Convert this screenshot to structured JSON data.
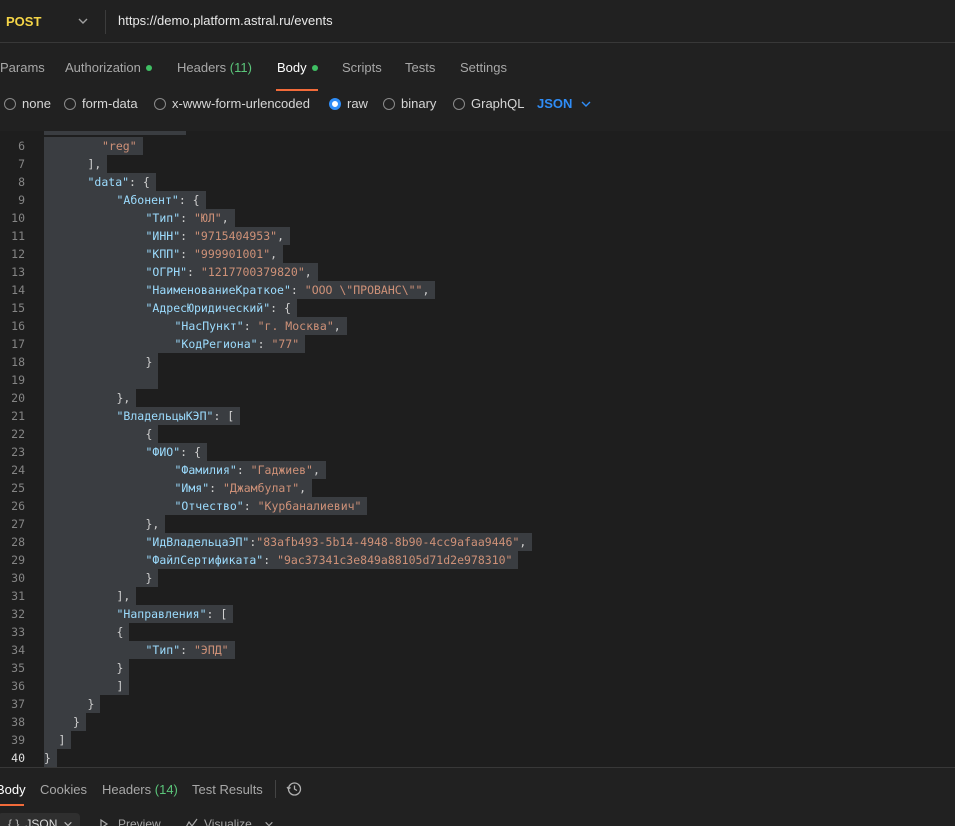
{
  "request": {
    "method": "POST",
    "url": "https://demo.platform.astral.ru/events"
  },
  "tabs": [
    {
      "label": "Params",
      "count": "",
      "dot": false
    },
    {
      "label": "Authorization",
      "count": "",
      "dot": true
    },
    {
      "label": "Headers",
      "count": "(11)",
      "dot": false
    },
    {
      "label": "Body",
      "count": "",
      "dot": true
    },
    {
      "label": "Scripts",
      "count": "",
      "dot": false
    },
    {
      "label": "Tests",
      "count": "",
      "dot": false
    },
    {
      "label": "Settings",
      "count": "",
      "dot": false
    }
  ],
  "body_types": [
    "none",
    "form-data",
    "x-www-form-urlencoded",
    "raw",
    "binary",
    "GraphQL"
  ],
  "body_type_selected": "raw",
  "format_select": "JSON",
  "accent_color": "#f26b3a",
  "code_lines": [
    {
      "n": "6",
      "indent": 4,
      "t": [
        [
          "s",
          "\"reg\""
        ]
      ]
    },
    {
      "n": "7",
      "indent": 3,
      "t": [
        [
          "p",
          "],"
        ]
      ]
    },
    {
      "n": "8",
      "indent": 3,
      "t": [
        [
          "k",
          "\"data\""
        ],
        [
          "p",
          ": {"
        ]
      ]
    },
    {
      "n": "9",
      "indent": 5,
      "t": [
        [
          "k",
          "\"Абонент\""
        ],
        [
          "p",
          ": {"
        ]
      ]
    },
    {
      "n": "10",
      "indent": 7,
      "t": [
        [
          "k",
          "\"Тип\""
        ],
        [
          "p",
          ": "
        ],
        [
          "s",
          "\"ЮЛ\""
        ],
        [
          "p",
          ","
        ]
      ]
    },
    {
      "n": "11",
      "indent": 7,
      "t": [
        [
          "k",
          "\"ИНН\""
        ],
        [
          "p",
          ": "
        ],
        [
          "s",
          "\"9715404953\""
        ],
        [
          "p",
          ","
        ]
      ]
    },
    {
      "n": "12",
      "indent": 7,
      "t": [
        [
          "k",
          "\"КПП\""
        ],
        [
          "p",
          ": "
        ],
        [
          "s",
          "\"999901001\""
        ],
        [
          "p",
          ","
        ]
      ]
    },
    {
      "n": "13",
      "indent": 7,
      "t": [
        [
          "k",
          "\"ОГРН\""
        ],
        [
          "p",
          ": "
        ],
        [
          "s",
          "\"1217700379820\""
        ],
        [
          "p",
          ","
        ]
      ]
    },
    {
      "n": "14",
      "indent": 7,
      "t": [
        [
          "k",
          "\"НаименованиеКраткое\""
        ],
        [
          "p",
          ": "
        ],
        [
          "s",
          "\"ООО \\\"ПРОВАНС\\\"\""
        ],
        [
          "p",
          ","
        ]
      ]
    },
    {
      "n": "15",
      "indent": 7,
      "t": [
        [
          "k",
          "\"АдресЮридический\""
        ],
        [
          "p",
          ": {"
        ]
      ]
    },
    {
      "n": "16",
      "indent": 9,
      "t": [
        [
          "k",
          "\"НасПункт\""
        ],
        [
          "p",
          ": "
        ],
        [
          "s",
          "\"г. Москва\""
        ],
        [
          "p",
          ","
        ]
      ]
    },
    {
      "n": "17",
      "indent": 9,
      "t": [
        [
          "k",
          "\"КодРегиона\""
        ],
        [
          "p",
          ": "
        ],
        [
          "s",
          "\"77\""
        ]
      ]
    },
    {
      "n": "18",
      "indent": 7,
      "t": [
        [
          "p",
          "}"
        ]
      ]
    },
    {
      "n": "19",
      "indent": 7,
      "t": [
        [
          "p",
          ""
        ]
      ]
    },
    {
      "n": "20",
      "indent": 5,
      "t": [
        [
          "p",
          "},"
        ]
      ]
    },
    {
      "n": "21",
      "indent": 5,
      "t": [
        [
          "k",
          "\"ВладельцыКЭП\""
        ],
        [
          "p",
          ": ["
        ]
      ]
    },
    {
      "n": "22",
      "indent": 7,
      "t": [
        [
          "p",
          "{"
        ]
      ]
    },
    {
      "n": "23",
      "indent": 7,
      "t": [
        [
          "k",
          "\"ФИО\""
        ],
        [
          "p",
          ": {"
        ]
      ]
    },
    {
      "n": "24",
      "indent": 9,
      "t": [
        [
          "k",
          "\"Фамилия\""
        ],
        [
          "p",
          ": "
        ],
        [
          "s",
          "\"Гаджиев\""
        ],
        [
          "p",
          ","
        ]
      ]
    },
    {
      "n": "25",
      "indent": 9,
      "t": [
        [
          "k",
          "\"Имя\""
        ],
        [
          "p",
          ": "
        ],
        [
          "s",
          "\"Джамбулат\""
        ],
        [
          "p",
          ","
        ]
      ]
    },
    {
      "n": "26",
      "indent": 9,
      "t": [
        [
          "k",
          "\"Отчество\""
        ],
        [
          "p",
          ": "
        ],
        [
          "s",
          "\"Курбаналиевич\""
        ]
      ]
    },
    {
      "n": "27",
      "indent": 7,
      "t": [
        [
          "p",
          "},"
        ]
      ]
    },
    {
      "n": "28",
      "indent": 7,
      "t": [
        [
          "k",
          "\"ИдВладельцаЭП\""
        ],
        [
          "p",
          ":"
        ],
        [
          "s",
          "\"83afb493-5b14-4948-8b90-4cc9afaa9446\""
        ],
        [
          "p",
          ","
        ]
      ]
    },
    {
      "n": "29",
      "indent": 7,
      "t": [
        [
          "k",
          "\"ФайлСертификата\""
        ],
        [
          "p",
          ": "
        ],
        [
          "s",
          "\"9ac37341c3e849a88105d71d2e978310\""
        ]
      ]
    },
    {
      "n": "30",
      "indent": 7,
      "t": [
        [
          "p",
          "}"
        ]
      ]
    },
    {
      "n": "31",
      "indent": 5,
      "t": [
        [
          "p",
          "],"
        ]
      ]
    },
    {
      "n": "32",
      "indent": 5,
      "t": [
        [
          "k",
          "\"Направления\""
        ],
        [
          "p",
          ": ["
        ]
      ]
    },
    {
      "n": "33",
      "indent": 5,
      "t": [
        [
          "p",
          "{"
        ]
      ]
    },
    {
      "n": "34",
      "indent": 7,
      "t": [
        [
          "k",
          "\"Тип\""
        ],
        [
          "p",
          ": "
        ],
        [
          "s",
          "\"ЭПД\""
        ]
      ]
    },
    {
      "n": "35",
      "indent": 5,
      "t": [
        [
          "p",
          "}"
        ]
      ]
    },
    {
      "n": "36",
      "indent": 5,
      "t": [
        [
          "p",
          "]"
        ]
      ]
    },
    {
      "n": "37",
      "indent": 3,
      "t": [
        [
          "p",
          "}"
        ]
      ]
    },
    {
      "n": "38",
      "indent": 2,
      "t": [
        [
          "p",
          "}"
        ]
      ]
    },
    {
      "n": "39",
      "indent": 1,
      "t": [
        [
          "p",
          "]"
        ]
      ]
    },
    {
      "n": "40",
      "indent": 0,
      "t": [
        [
          "p",
          "}"
        ]
      ]
    }
  ],
  "response": {
    "tabs": [
      {
        "label": "Body",
        "count": ""
      },
      {
        "label": "Cookies",
        "count": ""
      },
      {
        "label": "Headers",
        "count": "(14)"
      },
      {
        "label": "Test Results",
        "count": ""
      }
    ],
    "format": "JSON",
    "preview_label": "Preview",
    "visualize_label": "Visualize"
  }
}
